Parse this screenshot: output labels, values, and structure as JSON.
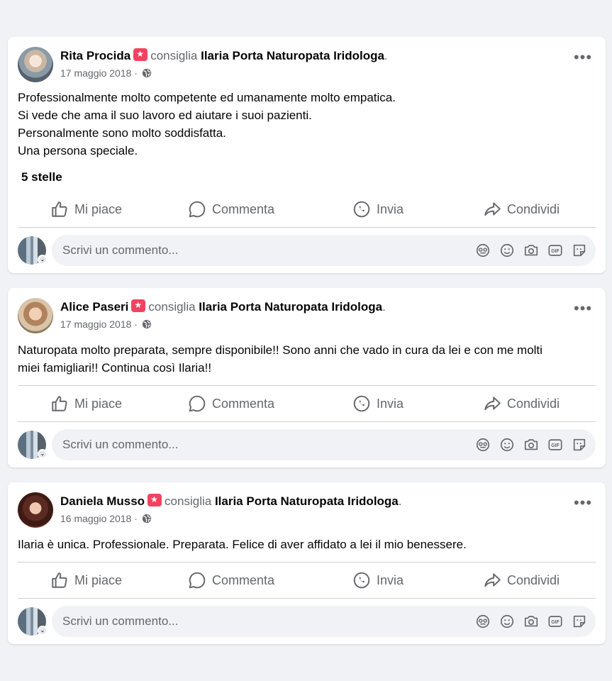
{
  "posts": [
    {
      "author": "Rita Procida",
      "verb": "consiglia",
      "page": "Ilaria Porta Naturopata Iridologa",
      "date": "17 maggio 2018",
      "text": "Professionalmente molto competente ed umanamente molto empatica.\nSi vede che ama il suo lavoro ed aiutare i suoi pazienti.\nPersonalmente sono molto soddisfatta.\nUna persona speciale.",
      "rating": "5 stelle"
    },
    {
      "author": "Alice Paseri",
      "verb": "consiglia",
      "page": "Ilaria Porta Naturopata Iridologa",
      "date": "17 maggio 2018",
      "text": "Naturopata molto preparata, sempre disponibile!! Sono anni che vado in cura da lei e con me molti\nmiei famigliari!! Continua così Ilaria!!"
    },
    {
      "author": "Daniela Musso",
      "verb": "consiglia",
      "page": "Ilaria Porta Naturopata Iridologa",
      "date": "16 maggio 2018",
      "text": "Ilaria è unica. Professionale. Preparata. Felice di aver affidato a lei il mio benessere."
    }
  ],
  "actions": {
    "like": "Mi piace",
    "comment": "Commenta",
    "send": "Invia",
    "share": "Condividi"
  },
  "comment_placeholder": "Scrivi un commento...",
  "icons": {
    "recommend": "recommend-star-icon",
    "privacy": "globe-icon",
    "more": "more-options-icon",
    "like": "thumbs-up-icon",
    "comment": "speech-bubble-icon",
    "send": "messenger-icon",
    "share": "share-arrow-icon",
    "composer": [
      "avatar-sticker-icon",
      "emoji-icon",
      "camera-icon",
      "gif-icon",
      "sticker-icon"
    ]
  },
  "colors": {
    "background": "#f0f2f5",
    "card": "#ffffff",
    "recommend_badge": "#f3425f",
    "secondary_text": "#65676b"
  }
}
